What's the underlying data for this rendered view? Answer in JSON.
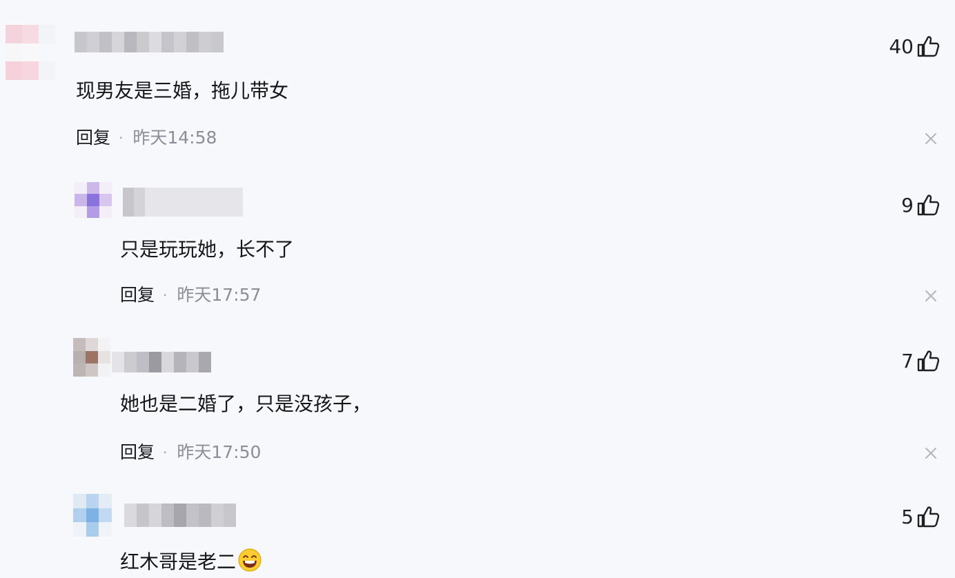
{
  "comments": [
    {
      "text": "现男友是三婚，拖儿带女",
      "likes": "40",
      "reply_label": "回复",
      "separator": "·",
      "time": "昨天14:58",
      "avatar_icon": "pink-pixelated-avatar"
    },
    {
      "text": "只是玩玩她，长不了",
      "likes": "9",
      "reply_label": "回复",
      "separator": "·",
      "time": "昨天17:57",
      "avatar_icon": "purple-pixelated-avatar"
    },
    {
      "text": "她也是二婚了，只是没孩子，",
      "likes": "7",
      "reply_label": "回复",
      "separator": "·",
      "time": "昨天17:50",
      "avatar_icon": "brown-pixelated-avatar"
    },
    {
      "text": "红木哥是老二",
      "likes": "5",
      "emoji": "laughing-emoji",
      "avatar_icon": "blue-pixelated-avatar"
    }
  ],
  "colors": {
    "background": "#f7f8fc",
    "text": "#161616",
    "meta": "#8c8c9a",
    "close_icon": "#b4b4c0"
  }
}
